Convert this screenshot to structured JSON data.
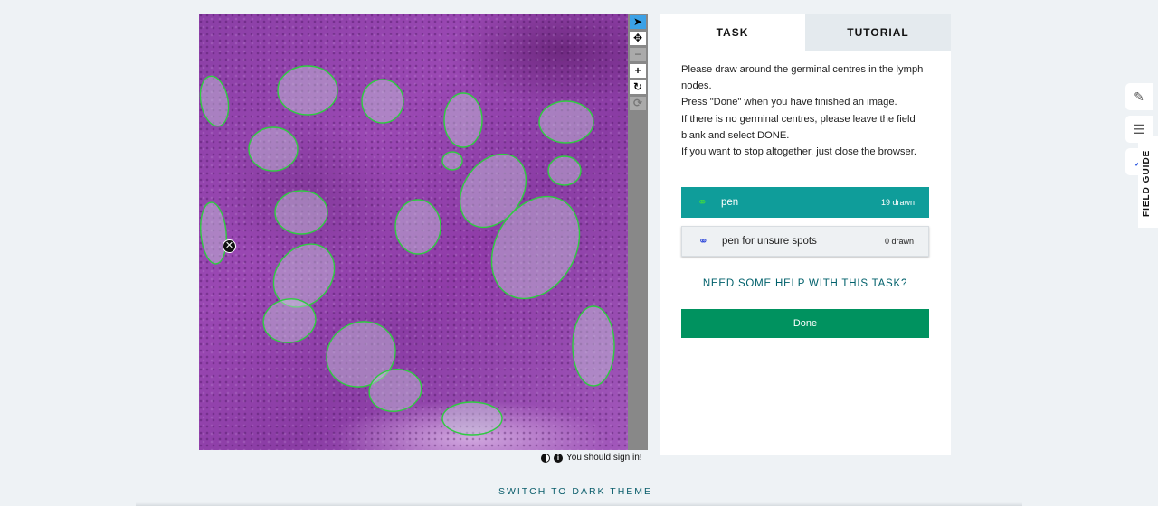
{
  "viewer": {
    "outline_color": "#2ecc40",
    "marking_count": 19,
    "toolbar": [
      {
        "name": "pointer-icon",
        "glyph": "➤",
        "state": "active"
      },
      {
        "name": "move-icon",
        "glyph": "✥",
        "state": "normal"
      },
      {
        "name": "zoom-out-icon",
        "glyph": "−",
        "state": "disabled"
      },
      {
        "name": "zoom-in-icon",
        "glyph": "+",
        "state": "normal"
      },
      {
        "name": "rotate-icon",
        "glyph": "↻",
        "state": "normal"
      },
      {
        "name": "reset-icon",
        "glyph": "⟳",
        "state": "disabled"
      }
    ]
  },
  "signin": {
    "text": "You should sign in!"
  },
  "tabs": [
    {
      "label": "TASK",
      "active": true
    },
    {
      "label": "TUTORIAL",
      "active": false
    }
  ],
  "task": {
    "instructions": [
      "Please draw around the germinal centres in the lymph nodes.",
      "Press \"Done\" when you have finished an image.",
      "If there is no germinal centres, please leave the field blank and select DONE.",
      "If you want to stop altogether, just close the browser."
    ],
    "tools": [
      {
        "label": "pen",
        "count": "19 drawn",
        "selected": true,
        "icon_color": "#3ad44a"
      },
      {
        "label": "pen for unsure spots",
        "count": "0 drawn",
        "selected": false,
        "icon_color": "#2b45d9"
      }
    ],
    "help_label": "NEED SOME HELP WITH THIS TASK?",
    "done_label": "Done"
  },
  "theme_toggle": "SWITCH TO DARK THEME",
  "field_guide": "FIELD GUIDE"
}
